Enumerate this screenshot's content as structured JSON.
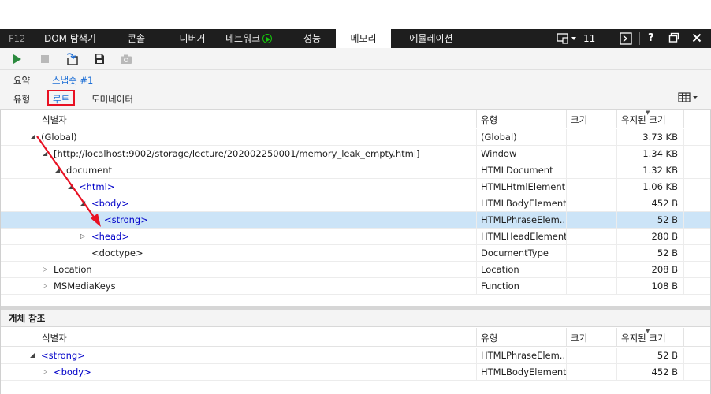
{
  "devtools": {
    "f12_label": "F12",
    "tabs": [
      {
        "label": "DOM 탐색기"
      },
      {
        "label": "콘솔"
      },
      {
        "label": "디버거"
      },
      {
        "label": "네트워크"
      },
      {
        "label": "성능"
      },
      {
        "label": "메모리",
        "active": true
      },
      {
        "label": "에뮬레이션"
      }
    ],
    "target_count": "11",
    "accent_color": "#16c60c"
  },
  "toolbar": {
    "icons": [
      "start-profiling-icon",
      "stop-profiling-icon",
      "import-icon",
      "save-icon",
      "take-snapshot-icon"
    ]
  },
  "subnav": {
    "summary_label": "요약",
    "snapshot_label": "스냅숏 #1",
    "view_tabs": [
      "유형",
      "루트",
      "도미네이터"
    ],
    "selected_view": "루트"
  },
  "grid": {
    "columns": [
      "식별자",
      "유형",
      "크기",
      "유지된 크기"
    ],
    "rows": [
      {
        "name": "(Global)",
        "type": "(Global)",
        "size": "",
        "retained": "3.73 KB",
        "depth": 0,
        "tw": "expanded",
        "tag": false
      },
      {
        "name": "[http://localhost:9002/storage/lecture/202002250001/memory_leak_empty.html]",
        "type": "Window",
        "size": "",
        "retained": "1.34 KB",
        "depth": 1,
        "tw": "expanded",
        "tag": false
      },
      {
        "name": "document",
        "type": "HTMLDocument",
        "size": "",
        "retained": "1.32 KB",
        "depth": 2,
        "tw": "expanded",
        "tag": false
      },
      {
        "name": "<html>",
        "type": "HTMLHtmlElement",
        "size": "",
        "retained": "1.06 KB",
        "depth": 3,
        "tw": "expanded",
        "tag": true
      },
      {
        "name": "<body>",
        "type": "HTMLBodyElement",
        "size": "",
        "retained": "452 B",
        "depth": 4,
        "tw": "expanded",
        "tag": true
      },
      {
        "name": "<strong>",
        "type": "HTMLPhraseElem...",
        "size": "",
        "retained": "52 B",
        "depth": 5,
        "tw": "none",
        "tag": true,
        "selected": true
      },
      {
        "name": "<head>",
        "type": "HTMLHeadElement",
        "size": "",
        "retained": "280 B",
        "depth": 4,
        "tw": "collapsed",
        "tag": true
      },
      {
        "name": "<doctype>",
        "type": "DocumentType",
        "size": "",
        "retained": "52 B",
        "depth": 4,
        "tw": "none",
        "tag": false
      },
      {
        "name": "Location",
        "type": "Location",
        "size": "",
        "retained": "208 B",
        "depth": 1,
        "tw": "collapsed",
        "tag": false
      },
      {
        "name": "MSMediaKeys",
        "type": "Function",
        "size": "",
        "retained": "108 B",
        "depth": 1,
        "tw": "collapsed",
        "tag": false
      }
    ]
  },
  "references": {
    "title": "개체 참조",
    "columns": [
      "식별자",
      "유형",
      "크기",
      "유지된 크기"
    ],
    "rows": [
      {
        "name": "<strong>",
        "type": "HTMLPhraseElem...",
        "size": "",
        "retained": "52 B",
        "depth": 0,
        "tw": "expanded",
        "tag": true
      },
      {
        "name": "<body>",
        "type": "HTMLBodyElement",
        "size": "",
        "retained": "452 B",
        "depth": 1,
        "tw": "collapsed",
        "tag": true
      }
    ]
  }
}
